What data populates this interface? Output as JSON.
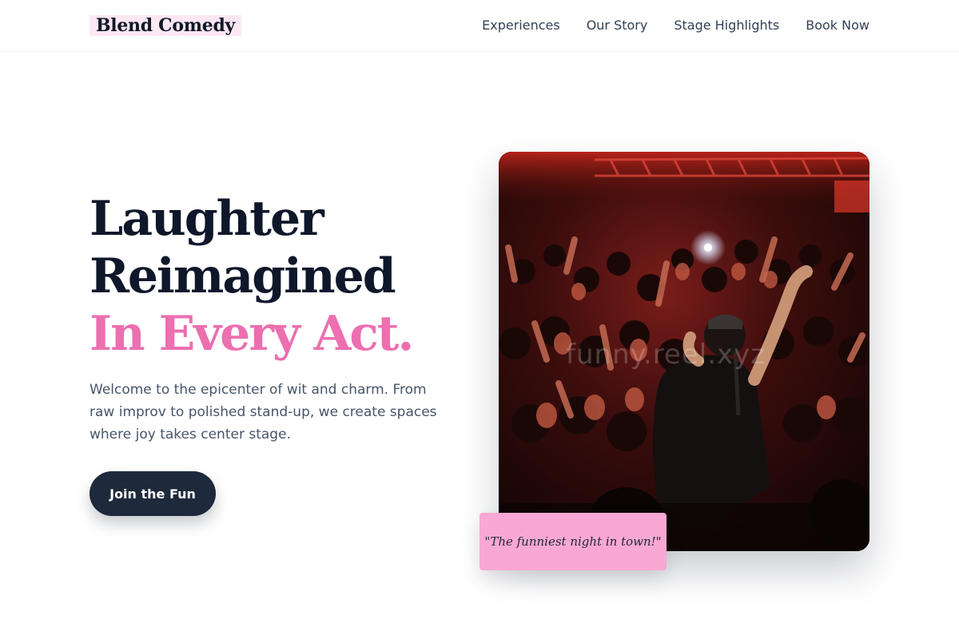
{
  "brand": {
    "name": "Blend Comedy"
  },
  "nav": {
    "items": [
      "Experiences",
      "Our Story",
      "Stage Highlights",
      "Book Now"
    ]
  },
  "hero": {
    "title_line1": "Laughter",
    "title_line2": "Reimagined",
    "title_accent": "In Every Act.",
    "description": "Welcome to the epicenter of wit and charm. From raw improv to polished stand-up, we create spaces where joy takes center stage.",
    "cta_label": "Join the Fun"
  },
  "photo": {
    "watermark": "funny.reel.xyz",
    "quote": "\"The funniest night in town!\""
  },
  "colors": {
    "accent_pink": "#ec6fb0",
    "quote_bg": "#f9a8d4",
    "logo_highlight": "#fce7f3",
    "dark": "#1e293b"
  }
}
